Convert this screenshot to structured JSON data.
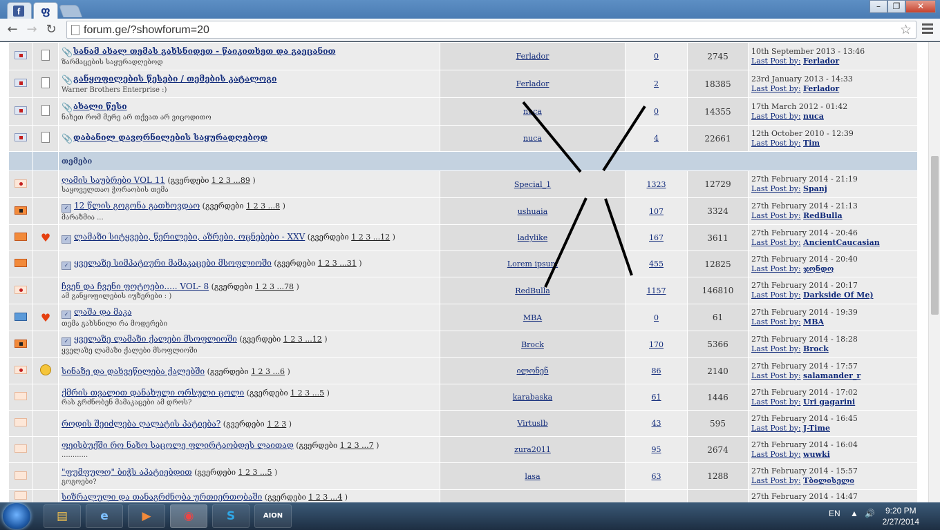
{
  "browser": {
    "tabs": [
      {
        "label": "f",
        "icon": "facebook-icon"
      },
      {
        "label": "ფ",
        "icon": "forum-ge-icon"
      }
    ],
    "url": "forum.ge/?showforum=20"
  },
  "section_label": "თემები",
  "pinned": [
    {
      "title": "სანამ ახალ თემას გახსნიდეთ - წაიკითხეთ და გაეცანით",
      "desc": "ზარმაცების საყურადღებოდ",
      "author": "Ferlador",
      "replies": "0",
      "views": "2745",
      "last_date": "10th September 2013 - 13:46",
      "last_by": "Ferlador"
    },
    {
      "title": "განყოფილების წესები / თემების კატალოგი",
      "desc": "Warner Brothers Enterprise :)",
      "author": "Ferlador",
      "replies": "2",
      "views": "18385",
      "last_date": "23rd January 2013 - 14:33",
      "last_by": "Ferlador"
    },
    {
      "title": "ახალი წესი",
      "desc": "ნახეთ რომ მერე არ თქვათ არ ვიცოდითო",
      "author": "nuca",
      "replies": "0",
      "views": "14355",
      "last_date": "17th March 2012 - 01:42",
      "last_by": "nuca"
    },
    {
      "title": "დაბანილ დავორნილების საყურადღებოდ",
      "desc": "",
      "author": "nuca",
      "replies": "4",
      "views": "22661",
      "last_date": "12th October 2010 - 12:39",
      "last_by": "Tim"
    }
  ],
  "topics": [
    {
      "title": "ღამის საუბრები VOL 11",
      "pages_label": "(გვერდები",
      "pages": "1 2 3 ...89",
      "desc": "საყოველთაო ჭორაობის თემა",
      "author": "Special_1",
      "replies": "1323",
      "views": "12729",
      "last_date": "27th February 2014 - 21:19",
      "last_by": "Spanj"
    },
    {
      "title": "12 წლის გოგონა გათხოვდაო",
      "pages_label": "(გვერდები",
      "pages": "1 2 3 ...8",
      "desc": "მარაზმია ...",
      "author": "ushuaia",
      "replies": "107",
      "views": "3324",
      "last_date": "27th February 2014 - 21:13",
      "last_by": "RedBulla"
    },
    {
      "title": "ლამაზი სიტყვები, წერილები, აზრები, ოცნებები - XXV",
      "pages_label": "(გვერდები",
      "pages": "1 2 3 ...12",
      "desc": "",
      "author": "ladylike",
      "replies": "167",
      "views": "3611",
      "last_date": "27th February 2014 - 20:46",
      "last_by": "AncientCaucasian"
    },
    {
      "title": "ყველაზე სიმპატიური მამაკაცები მსოფლიოში",
      "pages_label": "(გვერდები",
      "pages": "1 2 3 ...31",
      "desc": "",
      "author": "Lorem ipsum",
      "replies": "455",
      "views": "12825",
      "last_date": "27th February 2014 - 20:40",
      "last_by": "ჯონდო"
    },
    {
      "title": "ჩვენ და ჩვენი ფოტოები..... VOL- 8",
      "pages_label": "(გვერდები",
      "pages": "1 2 3 ...78",
      "desc": "ამ განყოფილების იუზერები : )",
      "author": "RedBulla",
      "replies": "1157",
      "views": "146810",
      "last_date": "27th February 2014 - 20:17",
      "last_by": "Darkside Of Me)"
    },
    {
      "title": "ლაშა და მაკა",
      "pages_label": "",
      "pages": "",
      "desc": "თემა გახსნილი რა მოდერები",
      "author": "MBA",
      "replies": "0",
      "views": "61",
      "last_date": "27th February 2014 - 19:39",
      "last_by": "MBA"
    },
    {
      "title": "ყველაზე ლამაზი ქალები მსოფლიოში",
      "pages_label": "(გვერდები",
      "pages": "1 2 3 ...12",
      "desc": "ყველაზე ლამაზი ქალები მსოფლიოში",
      "author": "Brock",
      "replies": "170",
      "views": "5366",
      "last_date": "27th February 2014 - 18:28",
      "last_by": "Brock"
    },
    {
      "title": "სინაზე და დახვეწილება ქალებში",
      "pages_label": "(გვერდები",
      "pages": "1 2 3 ...6",
      "desc": "",
      "author": "ილონენ",
      "replies": "86",
      "views": "2140",
      "last_date": "27th February 2014 - 17:57",
      "last_by": "salamander_r"
    },
    {
      "title": "ქმრის თვალით დანახული ორსული ცოლი",
      "pages_label": "(გვერდები",
      "pages": "1 2 3 ...5",
      "desc": "რას გრძნობენ მამაკაცები ამ დროს?",
      "author": "karabaska",
      "replies": "61",
      "views": "1446",
      "last_date": "27th February 2014 - 17:02",
      "last_by": "Uri gagarini"
    },
    {
      "title": "როდის შეიძლება ღალატის პატიება?",
      "pages_label": "(გვერდები",
      "pages": "1 2 3",
      "desc": "",
      "author": "Virtuslb",
      "replies": "43",
      "views": "595",
      "last_date": "27th February 2014 - 16:45",
      "last_by": "J-Time"
    },
    {
      "title": "ფეისბუქში რო ნახო საცოლე ფლირტაობდეს ლაითად",
      "pages_label": "(გვერდები",
      "pages": "1 2 3 ...7",
      "desc": "............",
      "author": "zura2011",
      "replies": "95",
      "views": "2674",
      "last_date": "27th February 2014 - 16:04",
      "last_by": "wuwki"
    },
    {
      "title": "\"ფუმფულო\" ბიჭს აპატიებდით",
      "pages_label": "(გვერდები",
      "pages": "1 2 3 ...5",
      "desc": "გოგოები?",
      "author": "lasa",
      "replies": "63",
      "views": "1288",
      "last_date": "27th February 2014 - 15:57",
      "last_by": "Tბილისელი"
    },
    {
      "title": "სიზრალული და თანაგრძნობა ურთიერთობაში",
      "pages_label": "(გვერდები",
      "pages": "1 2 3 ...4",
      "desc": "",
      "author": "",
      "replies": "",
      "views": "",
      "last_date": "27th February 2014 - 14:47",
      "last_by": ""
    }
  ],
  "last_post_label": "Last Post by:",
  "taskbar": {
    "lang": "EN",
    "time": "9:20 PM",
    "date": "2/27/2014",
    "apps": [
      "file-explorer-icon",
      "internet-explorer-icon",
      "media-player-icon",
      "chrome-icon",
      "skype-icon",
      "aion-icon"
    ]
  }
}
